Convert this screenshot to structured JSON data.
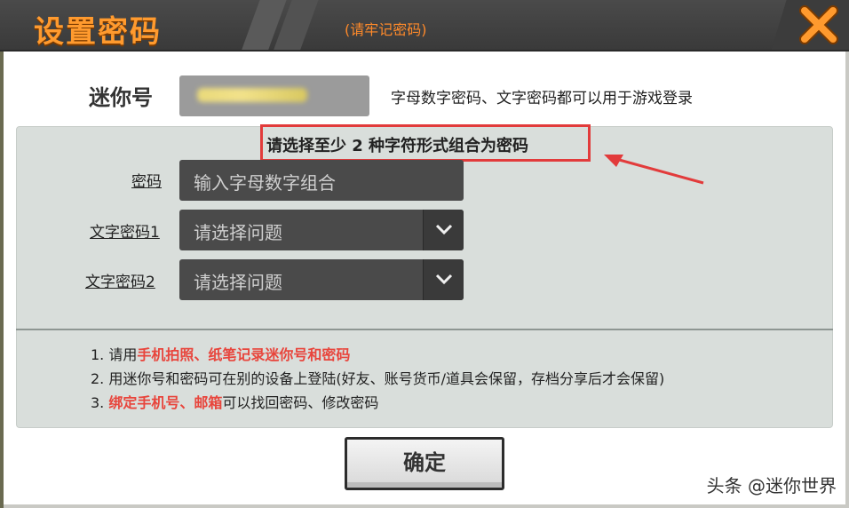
{
  "dialog": {
    "title": "设置密码",
    "subtitle": "(请牢记密码)",
    "close_icon": "close-icon",
    "accent_color": "#ff9a2e"
  },
  "mini_id": {
    "label": "迷你号",
    "note": "字母数字密码、文字密码都可以用于游戏登录"
  },
  "form": {
    "hint": "请选择至少 2 种字符形式组合为密码",
    "password": {
      "label": "密码",
      "placeholder": "输入字母数字组合"
    },
    "text_password_1": {
      "label": "文字密码1",
      "value": "请选择问题"
    },
    "text_password_2": {
      "label": "文字密码2",
      "value": "请选择问题"
    }
  },
  "tips": [
    {
      "prefix": "1. 请用",
      "highlight": "手机拍照、纸笔记录迷你号和密码",
      "suffix": ""
    },
    {
      "prefix": "2. 用迷你号和密码可在别的设备上登陆(好友、账号货币/道具会保留，存档分享后才会保留)",
      "highlight": "",
      "suffix": ""
    },
    {
      "prefix": "3. ",
      "highlight": "绑定手机号、邮箱",
      "suffix": "可以找回密码、修改密码"
    }
  ],
  "confirm_label": "确定",
  "watermark": "头条 @迷你世界",
  "colors": {
    "highlight_red": "#e8453c",
    "annotation_red": "#e23b3b"
  }
}
